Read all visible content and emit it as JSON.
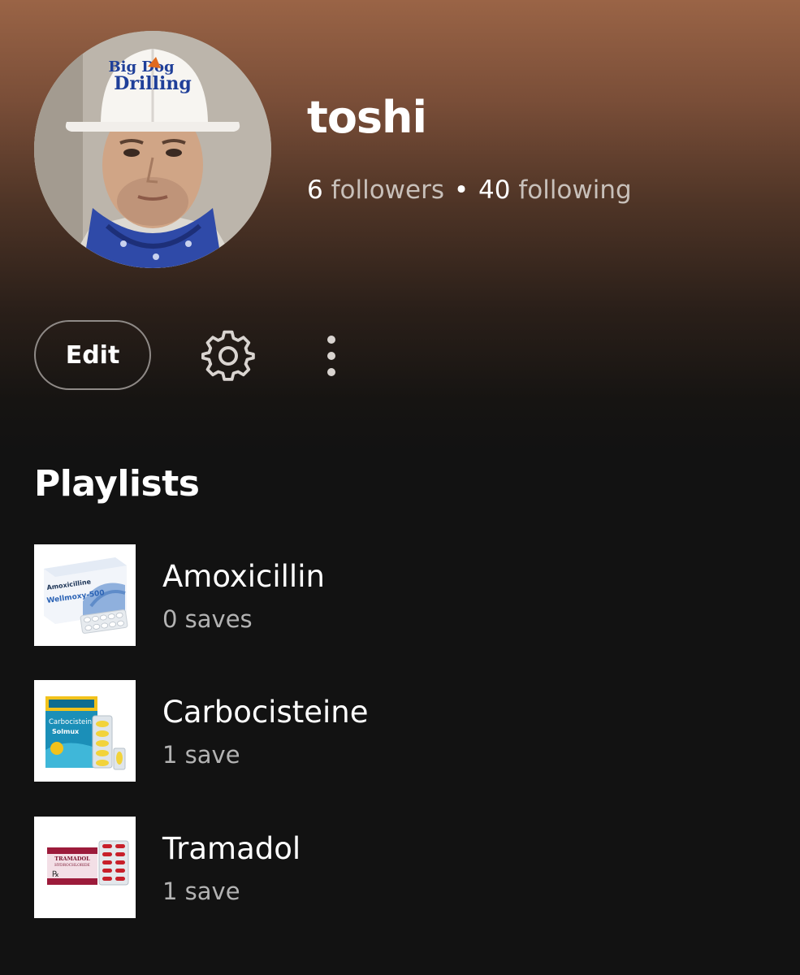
{
  "profile": {
    "username": "toshi",
    "followers_count": "6",
    "followers_label": "followers",
    "separator": "•",
    "following_count": "40",
    "following_label": "following",
    "hat_text_line1": "Big Dog",
    "hat_text_line2": "Drilling"
  },
  "actions": {
    "edit_label": "Edit",
    "settings_icon": "gear-icon",
    "more_icon": "more-vertical-icon"
  },
  "playlists": {
    "section_title": "Playlists",
    "items": [
      {
        "title": "Amoxicillin",
        "saves": "0 saves",
        "cover_text_1": "Amoxicilline",
        "cover_text_2": "Wellmoxy-500"
      },
      {
        "title": "Carbocisteine",
        "saves": "1 save",
        "cover_text_1": "Carbocisteine",
        "cover_text_2": "Solmux"
      },
      {
        "title": "Tramadol",
        "saves": "1 save",
        "cover_text_1": "TRAMADOL",
        "cover_text_2": "HYDROCHLORIDE"
      }
    ]
  },
  "colors": {
    "header_gradient_top": "#9a6446",
    "background": "#121212",
    "text_primary": "#ffffff",
    "text_secondary": "#b3b3b3"
  }
}
